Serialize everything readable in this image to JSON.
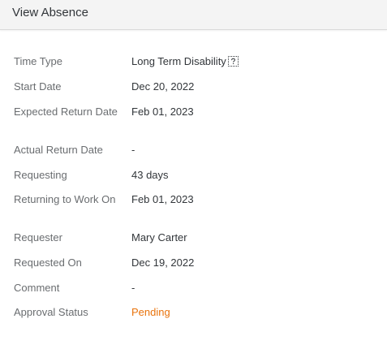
{
  "header": {
    "title": "View Absence"
  },
  "fields": {
    "time_type": {
      "label": "Time Type",
      "value": "Long Term Disability"
    },
    "start_date": {
      "label": "Start Date",
      "value": "Dec 20, 2022"
    },
    "expected_return_date": {
      "label": "Expected Return Date",
      "value": "Feb 01, 2023"
    },
    "actual_return_date": {
      "label": "Actual Return Date",
      "value": "-"
    },
    "requesting": {
      "label": "Requesting",
      "value": "43 days"
    },
    "returning_to_work_on": {
      "label": "Returning to Work On",
      "value": "Feb 01, 2023"
    },
    "requester": {
      "label": "Requester",
      "value": "Mary Carter"
    },
    "requested_on": {
      "label": "Requested On",
      "value": "Dec 19, 2022"
    },
    "comment": {
      "label": "Comment",
      "value": "-"
    },
    "approval_status": {
      "label": "Approval Status",
      "value": "Pending"
    }
  },
  "icons": {
    "time_type_help": "help-icon"
  },
  "colors": {
    "pending_status": "#e9730c",
    "label": "#6a6d70",
    "value": "#32363a",
    "header_bg": "#f4f4f4"
  }
}
